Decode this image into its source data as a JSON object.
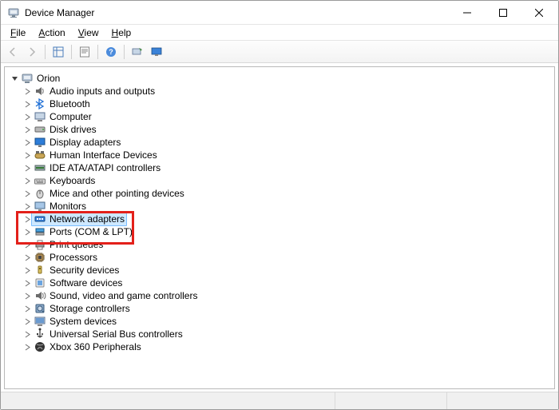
{
  "window": {
    "title": "Device Manager"
  },
  "menu": {
    "file": "File",
    "action": "Action",
    "view": "View",
    "help": "Help"
  },
  "toolbar": {
    "back": "back",
    "forward": "forward",
    "up": "up-container",
    "properties": "properties",
    "help": "help",
    "scan": "scan-hardware",
    "monitor": "show-hidden"
  },
  "tree": {
    "root": {
      "label": "Orion"
    },
    "items": [
      {
        "label": "Audio inputs and outputs",
        "icon": "speaker"
      },
      {
        "label": "Bluetooth",
        "icon": "bluetooth"
      },
      {
        "label": "Computer",
        "icon": "computer"
      },
      {
        "label": "Disk drives",
        "icon": "disk"
      },
      {
        "label": "Display adapters",
        "icon": "display"
      },
      {
        "label": "Human Interface Devices",
        "icon": "hid"
      },
      {
        "label": "IDE ATA/ATAPI controllers",
        "icon": "ide"
      },
      {
        "label": "Keyboards",
        "icon": "keyboard"
      },
      {
        "label": "Mice and other pointing devices",
        "icon": "mouse"
      },
      {
        "label": "Monitors",
        "icon": "monitor"
      },
      {
        "label": "Network adapters",
        "icon": "network",
        "selected": true
      },
      {
        "label": "Ports (COM & LPT)",
        "icon": "ports"
      },
      {
        "label": "Print queues",
        "icon": "printer"
      },
      {
        "label": "Processors",
        "icon": "cpu"
      },
      {
        "label": "Security devices",
        "icon": "security"
      },
      {
        "label": "Software devices",
        "icon": "software"
      },
      {
        "label": "Sound, video and game controllers",
        "icon": "sound"
      },
      {
        "label": "Storage controllers",
        "icon": "storage"
      },
      {
        "label": "System devices",
        "icon": "system"
      },
      {
        "label": "Universal Serial Bus controllers",
        "icon": "usb"
      },
      {
        "label": "Xbox 360 Peripherals",
        "icon": "xbox"
      }
    ]
  }
}
